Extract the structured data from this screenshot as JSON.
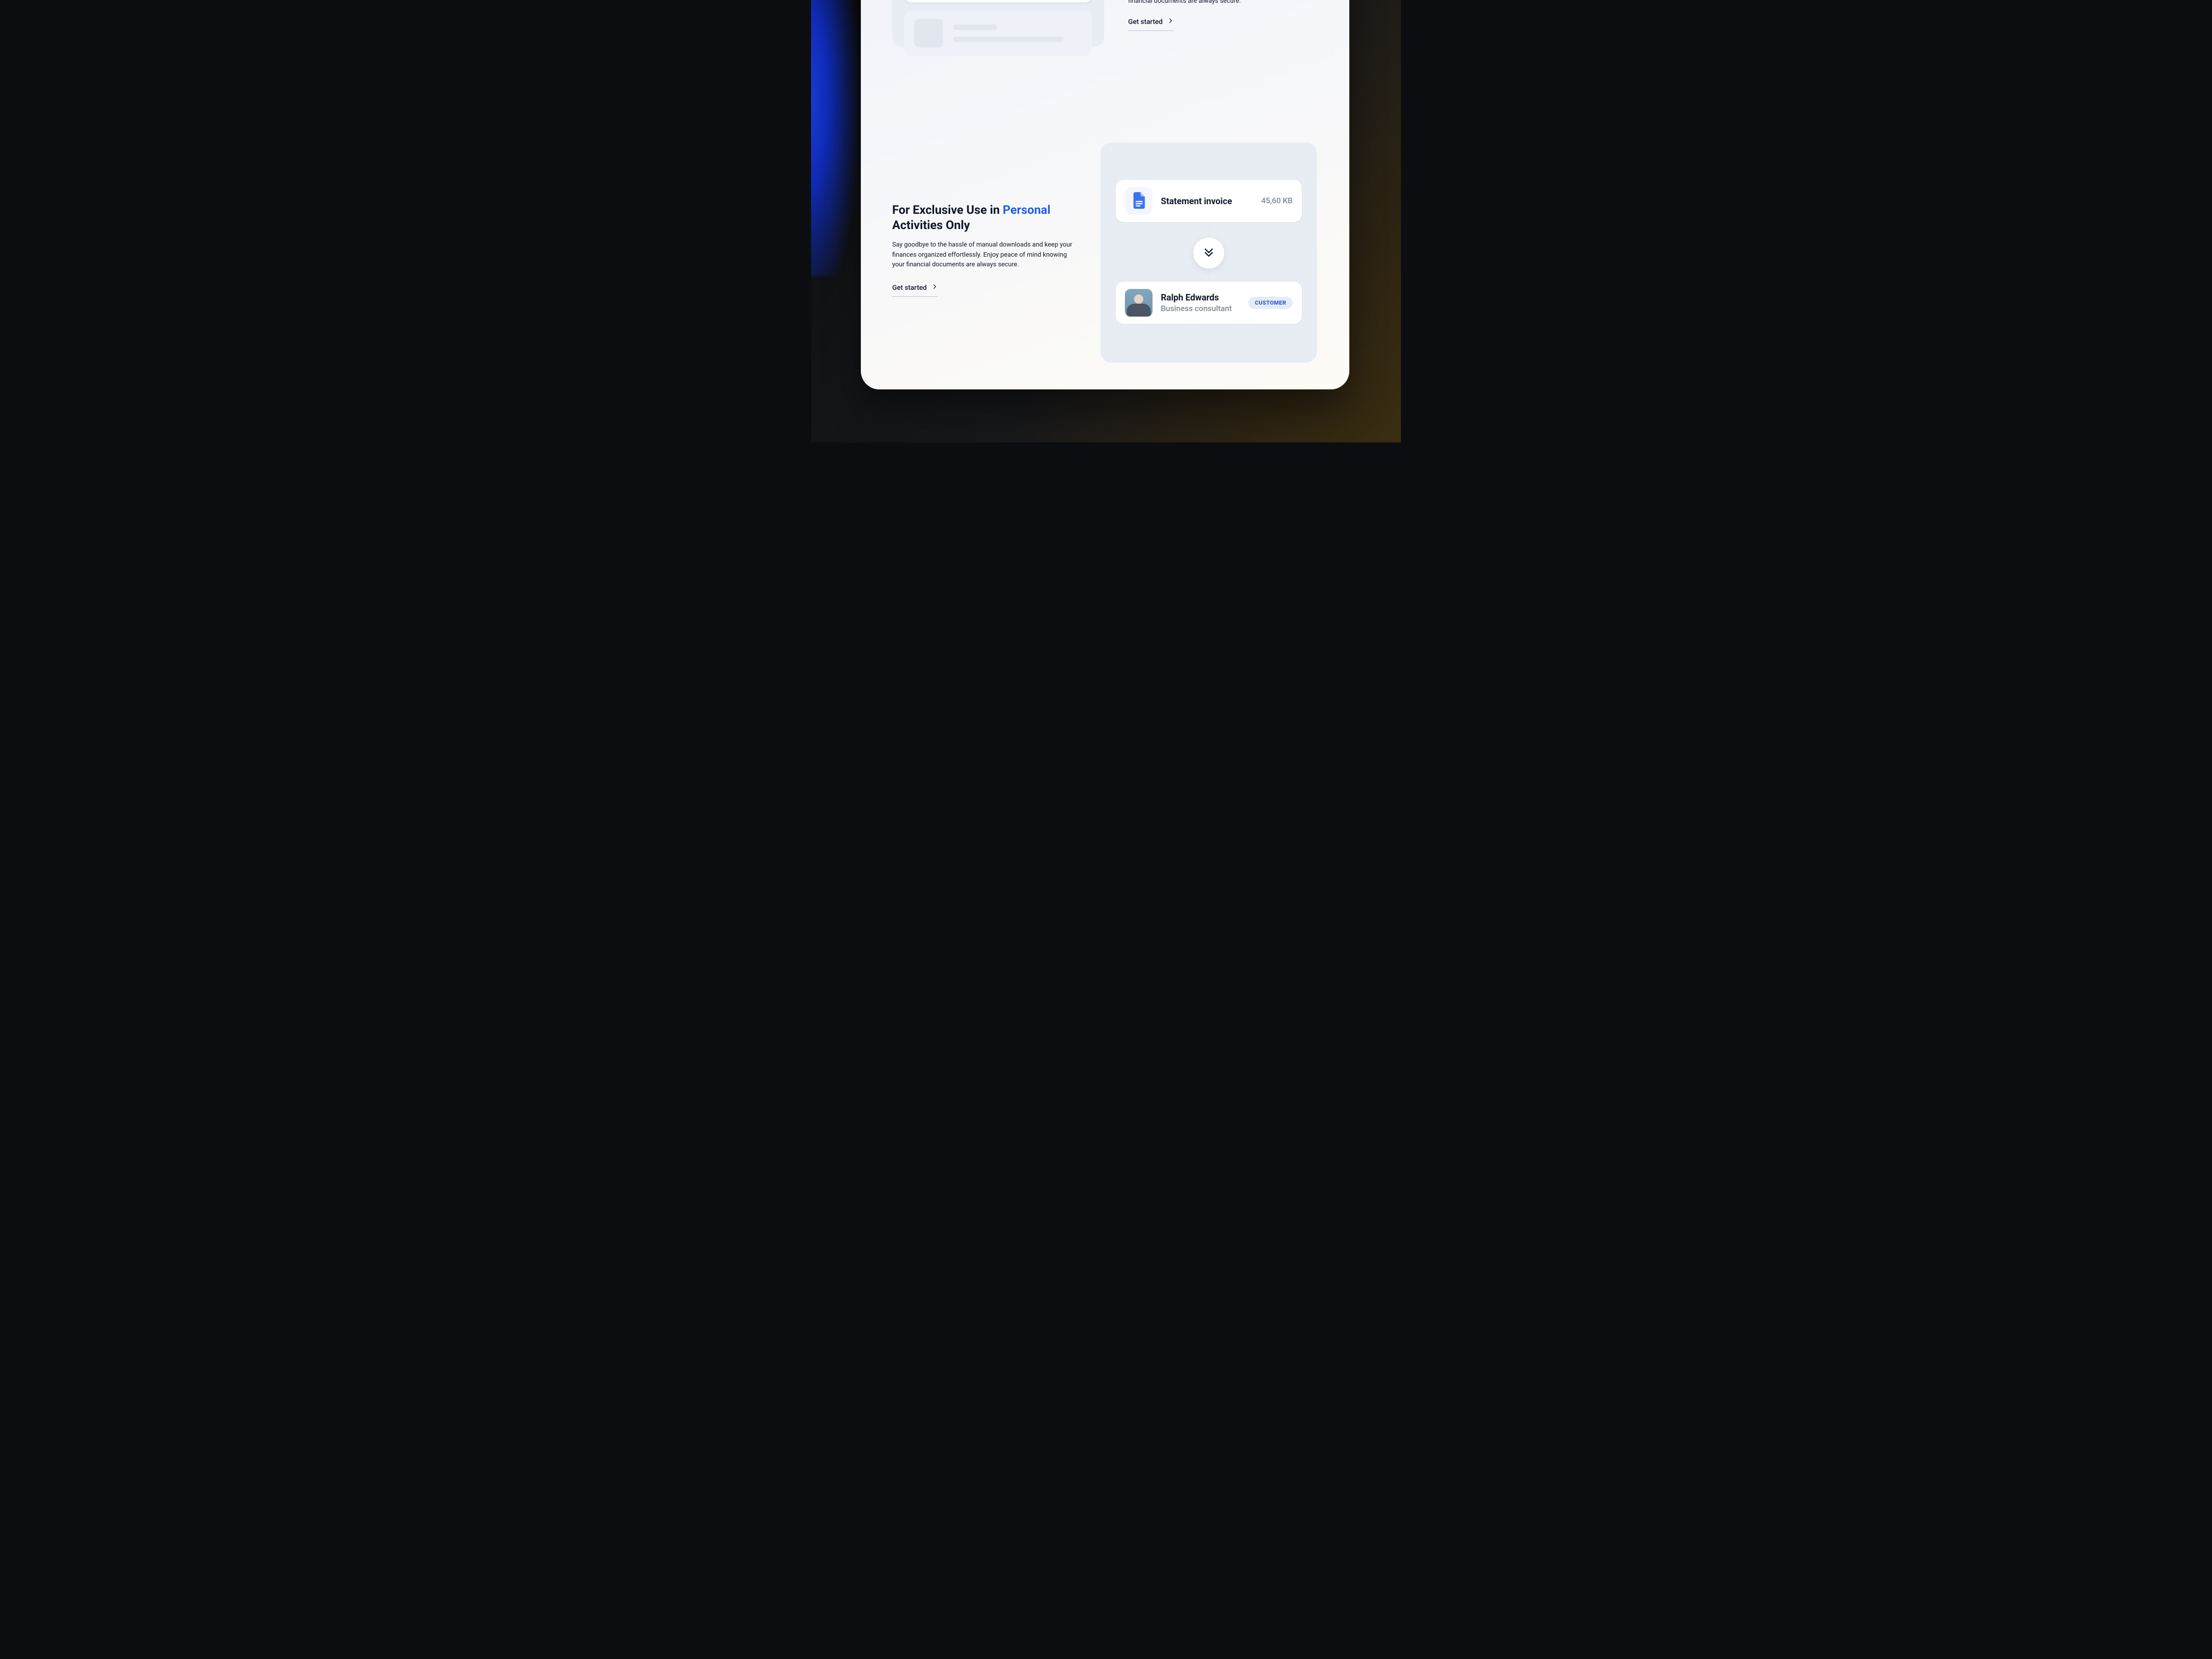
{
  "colors": {
    "accent": "#1e60e6",
    "badge_bg": "#e3ecf8",
    "badge_ink": "#2658d0",
    "muted": "#7e8896"
  },
  "top_right": {
    "body_visible": "financial documents are always secure.",
    "cta_label": "Get started"
  },
  "left_block": {
    "heading_pre": "For Exclusive Use in ",
    "heading_accent": "Personal",
    "heading_post": " Activities Only",
    "body": "Say goodbye to the hassle of manual downloads and keep your finances organized effortlessly. Enjoy peace of mind knowing your financial documents are always secure.",
    "cta_label": "Get started"
  },
  "diagram": {
    "file": {
      "title": "Statement invoice",
      "size": "45,60 KB",
      "icon_name": "doc-icon"
    },
    "arrow_icon_name": "double-chevron-down-icon",
    "person": {
      "name": "Ralph Edwards",
      "role": "Business consultant",
      "badge": "CUSTOMER"
    }
  }
}
